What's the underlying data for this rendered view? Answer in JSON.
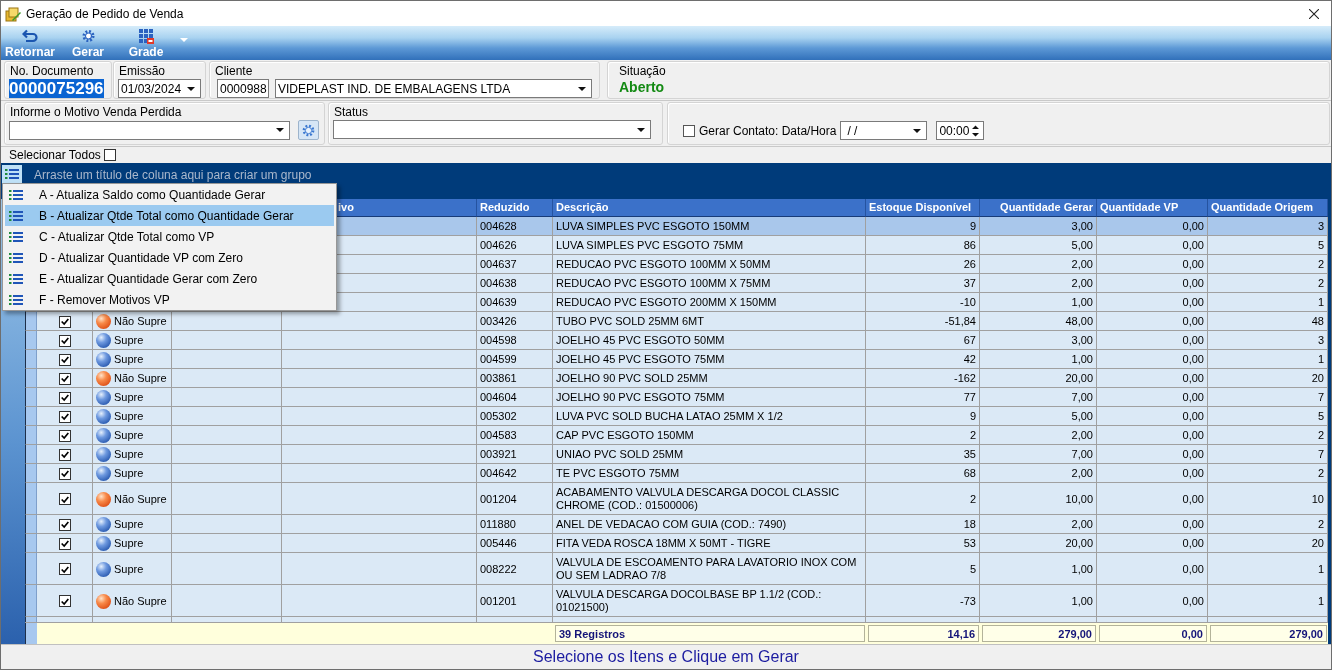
{
  "window": {
    "title": "Geração de Pedido de Venda"
  },
  "toolbar": {
    "buttons": [
      {
        "label": "Retornar",
        "kind": "back"
      },
      {
        "label": "Gerar",
        "kind": "generate"
      },
      {
        "label": "Grade",
        "kind": "grid"
      }
    ]
  },
  "header": {
    "document": {
      "label": "No. Documento",
      "value": "0000075296",
      "selected": true
    },
    "issue_date": {
      "label": "Emissão",
      "value": "01/03/2024"
    },
    "client": {
      "label": "Cliente",
      "code": "0000988",
      "name": "VIDEPLAST IND. DE EMBALAGENS LTDA"
    },
    "situation": {
      "label": "Situação",
      "value": "Aberto"
    }
  },
  "filters": {
    "lost_sale_reason": {
      "label": "Informe o Motivo Venda Perdida"
    },
    "status": {
      "label": "Status"
    },
    "contact": {
      "label": "Gerar Contato: Data/Hora",
      "checked": false,
      "date": "/ /",
      "time": "00:00"
    }
  },
  "select_all": {
    "label": "Selecionar Todos",
    "checked": false
  },
  "grid": {
    "group_hint": "Arraste um título de coluna aqui para criar um grupo",
    "columns": [
      {
        "label": "ivo"
      },
      {
        "label": "Reduzido"
      },
      {
        "label": "Descrição"
      },
      {
        "label": "Estoque Disponível"
      },
      {
        "label": "Quantidade Gerar"
      },
      {
        "label": "Quantidade VP"
      },
      {
        "label": "Quantidade Origem"
      }
    ],
    "rows": [
      {
        "selected": true,
        "code": "004628",
        "description": "LUVA SIMPLES PVC ESGOTO 150MM",
        "stock": "9",
        "qty_generate": "3,00",
        "qty_vp": "0,00",
        "qty_origin": "3"
      },
      {
        "selected": false,
        "code": "004626",
        "description": "LUVA SIMPLES PVC ESGOTO 75MM",
        "stock": "86",
        "qty_generate": "5,00",
        "qty_vp": "0,00",
        "qty_origin": "5"
      },
      {
        "selected": false,
        "code": "004637",
        "description": "REDUCAO PVC ESGOTO 100MM X 50MM",
        "stock": "26",
        "qty_generate": "2,00",
        "qty_vp": "0,00",
        "qty_origin": "2"
      },
      {
        "selected": false,
        "code": "004638",
        "description": "REDUCAO PVC ESGOTO 100MM X 75MM",
        "stock": "37",
        "qty_generate": "2,00",
        "qty_vp": "0,00",
        "qty_origin": "2"
      },
      {
        "selected": false,
        "code": "004639",
        "description": "REDUCAO PVC ESGOTO 200MM X 150MM",
        "stock": "-10",
        "qty_generate": "1,00",
        "qty_vp": "0,00",
        "qty_origin": "1"
      },
      {
        "selected": false,
        "checked": true,
        "status": {
          "kind": "nao_supre",
          "label": "Não Supre"
        },
        "code": "003426",
        "description": "TUBO PVC SOLD 25MM 6MT",
        "stock": "-51,84",
        "qty_generate": "48,00",
        "qty_vp": "0,00",
        "qty_origin": "48"
      },
      {
        "selected": false,
        "checked": true,
        "status": {
          "kind": "supre",
          "label": "Supre"
        },
        "code": "004598",
        "description": "JOELHO 45 PVC ESGOTO 50MM",
        "stock": "67",
        "qty_generate": "3,00",
        "qty_vp": "0,00",
        "qty_origin": "3"
      },
      {
        "selected": false,
        "checked": true,
        "status": {
          "kind": "supre",
          "label": "Supre"
        },
        "code": "004599",
        "description": "JOELHO 45 PVC ESGOTO 75MM",
        "stock": "42",
        "qty_generate": "1,00",
        "qty_vp": "0,00",
        "qty_origin": "1"
      },
      {
        "selected": false,
        "checked": true,
        "status": {
          "kind": "nao_supre",
          "label": "Não Supre"
        },
        "code": "003861",
        "description": "JOELHO 90 PVC SOLD 25MM",
        "stock": "-162",
        "qty_generate": "20,00",
        "qty_vp": "0,00",
        "qty_origin": "20"
      },
      {
        "selected": false,
        "checked": true,
        "status": {
          "kind": "supre",
          "label": "Supre"
        },
        "code": "004604",
        "description": "JOELHO 90 PVC ESGOTO 75MM",
        "stock": "77",
        "qty_generate": "7,00",
        "qty_vp": "0,00",
        "qty_origin": "7"
      },
      {
        "selected": false,
        "checked": true,
        "status": {
          "kind": "supre",
          "label": "Supre"
        },
        "code": "005302",
        "description": "LUVA PVC SOLD BUCHA LATAO 25MM X 1/2",
        "stock": "9",
        "qty_generate": "5,00",
        "qty_vp": "0,00",
        "qty_origin": "5"
      },
      {
        "selected": false,
        "checked": true,
        "status": {
          "kind": "supre",
          "label": "Supre"
        },
        "code": "004583",
        "description": "CAP PVC ESGOTO 150MM",
        "stock": "2",
        "qty_generate": "2,00",
        "qty_vp": "0,00",
        "qty_origin": "2"
      },
      {
        "selected": false,
        "checked": true,
        "status": {
          "kind": "supre",
          "label": "Supre"
        },
        "code": "003921",
        "description": "UNIAO PVC SOLD 25MM",
        "stock": "35",
        "qty_generate": "7,00",
        "qty_vp": "0,00",
        "qty_origin": "7"
      },
      {
        "selected": false,
        "checked": true,
        "status": {
          "kind": "supre",
          "label": "Supre"
        },
        "code": "004642",
        "description": "TE PVC ESGOTO 75MM",
        "stock": "68",
        "qty_generate": "2,00",
        "qty_vp": "0,00",
        "qty_origin": "2"
      },
      {
        "selected": false,
        "checked": true,
        "status": {
          "kind": "nao_supre",
          "label": "Não Supre"
        },
        "code": "001204",
        "description": "ACABAMENTO VALVULA DESCARGA DOCOL CLASSIC CHROME (COD.: 01500006)",
        "stock": "2",
        "qty_generate": "10,00",
        "qty_vp": "0,00",
        "qty_origin": "10"
      },
      {
        "selected": false,
        "checked": true,
        "status": {
          "kind": "supre",
          "label": "Supre"
        },
        "code": "011880",
        "description": "ANEL DE VEDACAO COM GUIA (COD.: 7490)",
        "stock": "18",
        "qty_generate": "2,00",
        "qty_vp": "0,00",
        "qty_origin": "2"
      },
      {
        "selected": false,
        "checked": true,
        "status": {
          "kind": "supre",
          "label": "Supre"
        },
        "code": "005446",
        "description": "FITA VEDA ROSCA 18MM X 50MT - TIGRE",
        "stock": "53",
        "qty_generate": "20,00",
        "qty_vp": "0,00",
        "qty_origin": "20"
      },
      {
        "selected": false,
        "checked": true,
        "status": {
          "kind": "supre",
          "label": "Supre"
        },
        "code": "008222",
        "description": "VALVULA DE ESCOAMENTO PARA LAVATORIO INOX COM OU SEM LADRAO 7/8",
        "stock": "5",
        "qty_generate": "1,00",
        "qty_vp": "0,00",
        "qty_origin": "1"
      },
      {
        "selected": false,
        "checked": true,
        "status": {
          "kind": "nao_supre",
          "label": "Não Supre"
        },
        "code": "001201",
        "description": "VALVULA DESCARGA DOCOLBASE BP 1.1/2 (COD.: 01021500)",
        "stock": "-73",
        "qty_generate": "1,00",
        "qty_vp": "0,00",
        "qty_origin": "1"
      }
    ],
    "footer": {
      "count": "39 Registros",
      "totals": [
        "14,16",
        "279,00",
        "0,00",
        "279,00"
      ]
    }
  },
  "context_menu": {
    "items": [
      {
        "label": "A - Atualiza Saldo como Quantidade Gerar",
        "selected": false
      },
      {
        "label": "B - Atualizar Qtde Total como Quantidade Gerar",
        "selected": true
      },
      {
        "label": "C - Atualizar Qtde Total como VP",
        "selected": false
      },
      {
        "label": "D - Atualizar Quantidade VP com Zero",
        "selected": false
      },
      {
        "label": "E - Atualizar Quantidade Gerar com Zero",
        "selected": false
      },
      {
        "label": "F - Remover Motivos VP",
        "selected": false
      }
    ]
  },
  "status_bar": {
    "text": "Selecione os Itens e Clique em Gerar"
  }
}
